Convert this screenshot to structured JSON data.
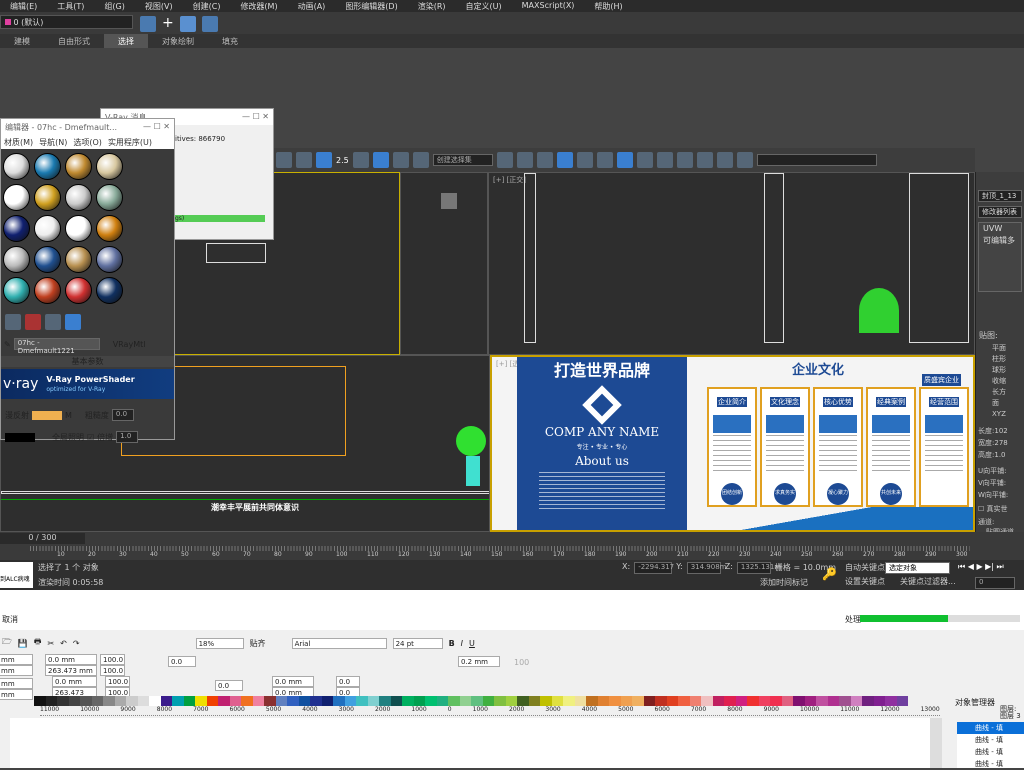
{
  "menu": [
    "编辑(E)",
    "工具(T)",
    "组(G)",
    "视图(V)",
    "创建(C)",
    "修改器(M)",
    "动画(A)",
    "图形编辑器(D)",
    "渲染(R)",
    "自定义(U)",
    "MAXScript(X)",
    "帮助(H)"
  ],
  "layer": "0 (默认)",
  "ribbon_tabs": [
    "建模",
    "自由形式",
    "选择",
    "对象绘制",
    "填充"
  ],
  "ribbon_active": 2,
  "main_toolbar": {
    "selection_set": "创建选择集",
    "snap_value": "2.5"
  },
  "viewports": {
    "top_right_label": "[+] [正交]",
    "bottom_right_label": "[+] [透视] [明暗处理]",
    "bottom_left_caption": "潮幸丰平展前共同体意识",
    "render": {
      "slogan": "打造世界品牌",
      "company": "COMP ANY NAME",
      "tagline": "专注 • 专业 • 专心",
      "about": "About us",
      "culture": "企业文化",
      "boards": [
        "企业简介",
        "文化理念",
        "核心优势",
        "经典案例",
        "经营范围"
      ],
      "badges": [
        "团结创新",
        "求真务实",
        "凝心聚力",
        "共创未来"
      ],
      "banner": "质盛宾企业"
    }
  },
  "vray_msg": {
    "title": "V-Ray 消息",
    "line": "itives: 866790",
    "progress_text": "gs)"
  },
  "mat_editor": {
    "title": "编辑器 - 07hc - Dmefmault...",
    "menus": [
      "材质(M)",
      "导航(N)",
      "选项(O)",
      "实用程序(U)"
    ],
    "material_name": "07hc - Dmefmault1221",
    "material_type": "VRayMtl",
    "rollout": "基本参数",
    "banner_logo": "v·ray",
    "banner_title": "V-Ray PowerShader",
    "banner_sub": "optimized for V-Ray",
    "diffuse_label": "漫反射",
    "diffuse_color": "#f0b050",
    "m_btn": "M",
    "roughness_label": "粗糙度",
    "roughness": "0.0",
    "global_label": "全局照明",
    "multiplier_label": "倍增",
    "multiplier": "1.0"
  },
  "command_panel": {
    "object_name": "封顶_1_13",
    "modifier_list": "修改器列表",
    "stack": [
      "UVW",
      "可编辑多"
    ],
    "map_label": "贴图:",
    "map_types": [
      "平面",
      "柱形",
      "球形",
      "收缩",
      "长方",
      "面",
      "XYZ"
    ],
    "length_label": "长度:",
    "length": "102",
    "width_label": "宽度:",
    "width": "278",
    "height_label": "高度:",
    "height": "1.0",
    "u_label": "U向平铺:",
    "v_label": "V向平铺:",
    "w_label": "W向平铺:",
    "real_world": "真实世",
    "channel_label": "通道:",
    "channel_opts": [
      "贴图通道",
      "顶点颜色"
    ]
  },
  "timeline": {
    "frame": "0 / 300",
    "ticks": [
      "10",
      "20",
      "30",
      "40",
      "50",
      "60",
      "70",
      "80",
      "90",
      "100",
      "110",
      "120",
      "130",
      "140",
      "150",
      "160",
      "170",
      "180",
      "190",
      "200",
      "210",
      "220",
      "230",
      "240",
      "250",
      "260",
      "270",
      "280",
      "290",
      "300"
    ]
  },
  "status": {
    "left_btn": "到ALC病魂",
    "selected": "选择了 1 个 对象",
    "render_time": "渲染时间 0:05:58",
    "x": "-2294.317",
    "y": "314.908m",
    "z": "1325.131m",
    "grid": "栅格 = 10.0mm",
    "add_time_tag": "添加时间标记",
    "auto_key": "自动关键点",
    "set_key": "设置关键点",
    "selected_obj": "选定对象",
    "key_filter": "关键点过滤器...",
    "frame_field": "0"
  },
  "corel": {
    "cancel": "取消",
    "processing": "处理",
    "progress": 0.55,
    "zoom": "18%",
    "snap": "贴齐",
    "font": "Arial",
    "size": "24 pt",
    "x1": "0.0 mm",
    "h1": "263.473 mm",
    "pct": "100.0",
    "pct_sym": "%",
    "rot": "0.0",
    "outline": "0.2 mm",
    "opacity": "100",
    "x2": "0.0 mm",
    "h2": "263.473 mm",
    "pos_a": "0.0 mm",
    "pos_b": "0.0 mm",
    "skew_a": "0.0",
    "skew_b": "0.0",
    "val_mm": "mm",
    "obj_mgr": "对象管理器",
    "layer_label": "图层:",
    "layer_val": "图层 3",
    "objects": [
      "曲线 - 填",
      "曲线 - 填",
      "曲线 - 填",
      "曲线 - 填"
    ],
    "ruler": [
      "11000",
      "10000",
      "9000",
      "8000",
      "7000",
      "6000",
      "5000",
      "4000",
      "3000",
      "2000",
      "1000",
      "0",
      "1000",
      "2000",
      "3000",
      "4000",
      "5000",
      "6000",
      "7000",
      "8000",
      "9000",
      "10000",
      "11000",
      "12000",
      "13000"
    ],
    "palette": [
      "#111",
      "#222",
      "#333",
      "#444",
      "#555",
      "#666",
      "#888",
      "#aaa",
      "#ccc",
      "#ddd",
      "#fff",
      "#3b1c8c",
      "#00a0b0",
      "#00a040",
      "#f0e000",
      "#f04000",
      "#c02070",
      "#e06090",
      "#f07020",
      "#f080a0",
      "#8a3030",
      "#6080c0",
      "#3060c0",
      "#1050a0",
      "#203090",
      "#102070",
      "#2070c0",
      "#40a0e0",
      "#40c0c0",
      "#80d0d0",
      "#208080",
      "#105050",
      "#00b060",
      "#00a050",
      "#00c070",
      "#20b080",
      "#60c060",
      "#90d090",
      "#60c080",
      "#40b040",
      "#80c040",
      "#a0d040",
      "#406020",
      "#808020",
      "#c0c000",
      "#e0e040",
      "#f0f080",
      "#f0e0a0",
      "#c07020",
      "#e08030",
      "#f09040",
      "#f0a050",
      "#f0b060",
      "#802020",
      "#c03020",
      "#e04020",
      "#f06040",
      "#f08070",
      "#f0c0c0",
      "#c02060",
      "#e02050",
      "#d02080",
      "#f03030",
      "#f04060",
      "#f03050",
      "#e06080",
      "#801070",
      "#a02080",
      "#c050a0",
      "#b03090",
      "#a05090",
      "#d080c0",
      "#702080",
      "#802090",
      "#9030a0",
      "#7040a0"
    ]
  }
}
